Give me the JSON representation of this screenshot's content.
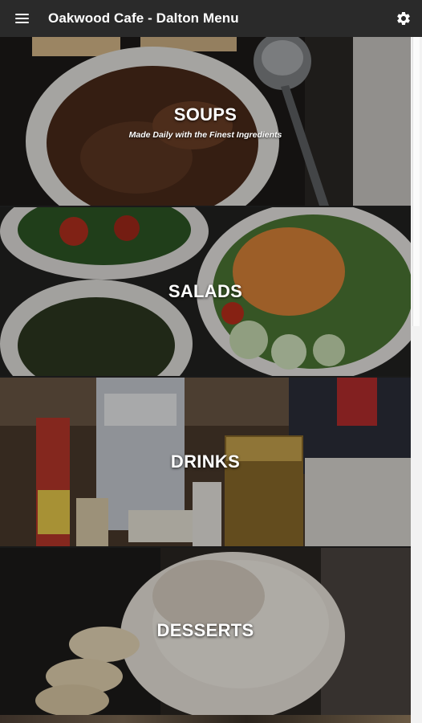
{
  "app_bar": {
    "title": "Oakwood Cafe - Dalton Menu",
    "menu_icon": "hamburger-menu-icon",
    "settings_icon": "gear-icon"
  },
  "categories": [
    {
      "label": "SOUPS",
      "subtitle": "Made Daily with the Finest Ingredients"
    },
    {
      "label": "SALADS"
    },
    {
      "label": "DRINKS"
    },
    {
      "label": "DESSERTS"
    }
  ],
  "colors": {
    "app_bar": "#2a2a2a",
    "label_text": "#ffffff"
  }
}
